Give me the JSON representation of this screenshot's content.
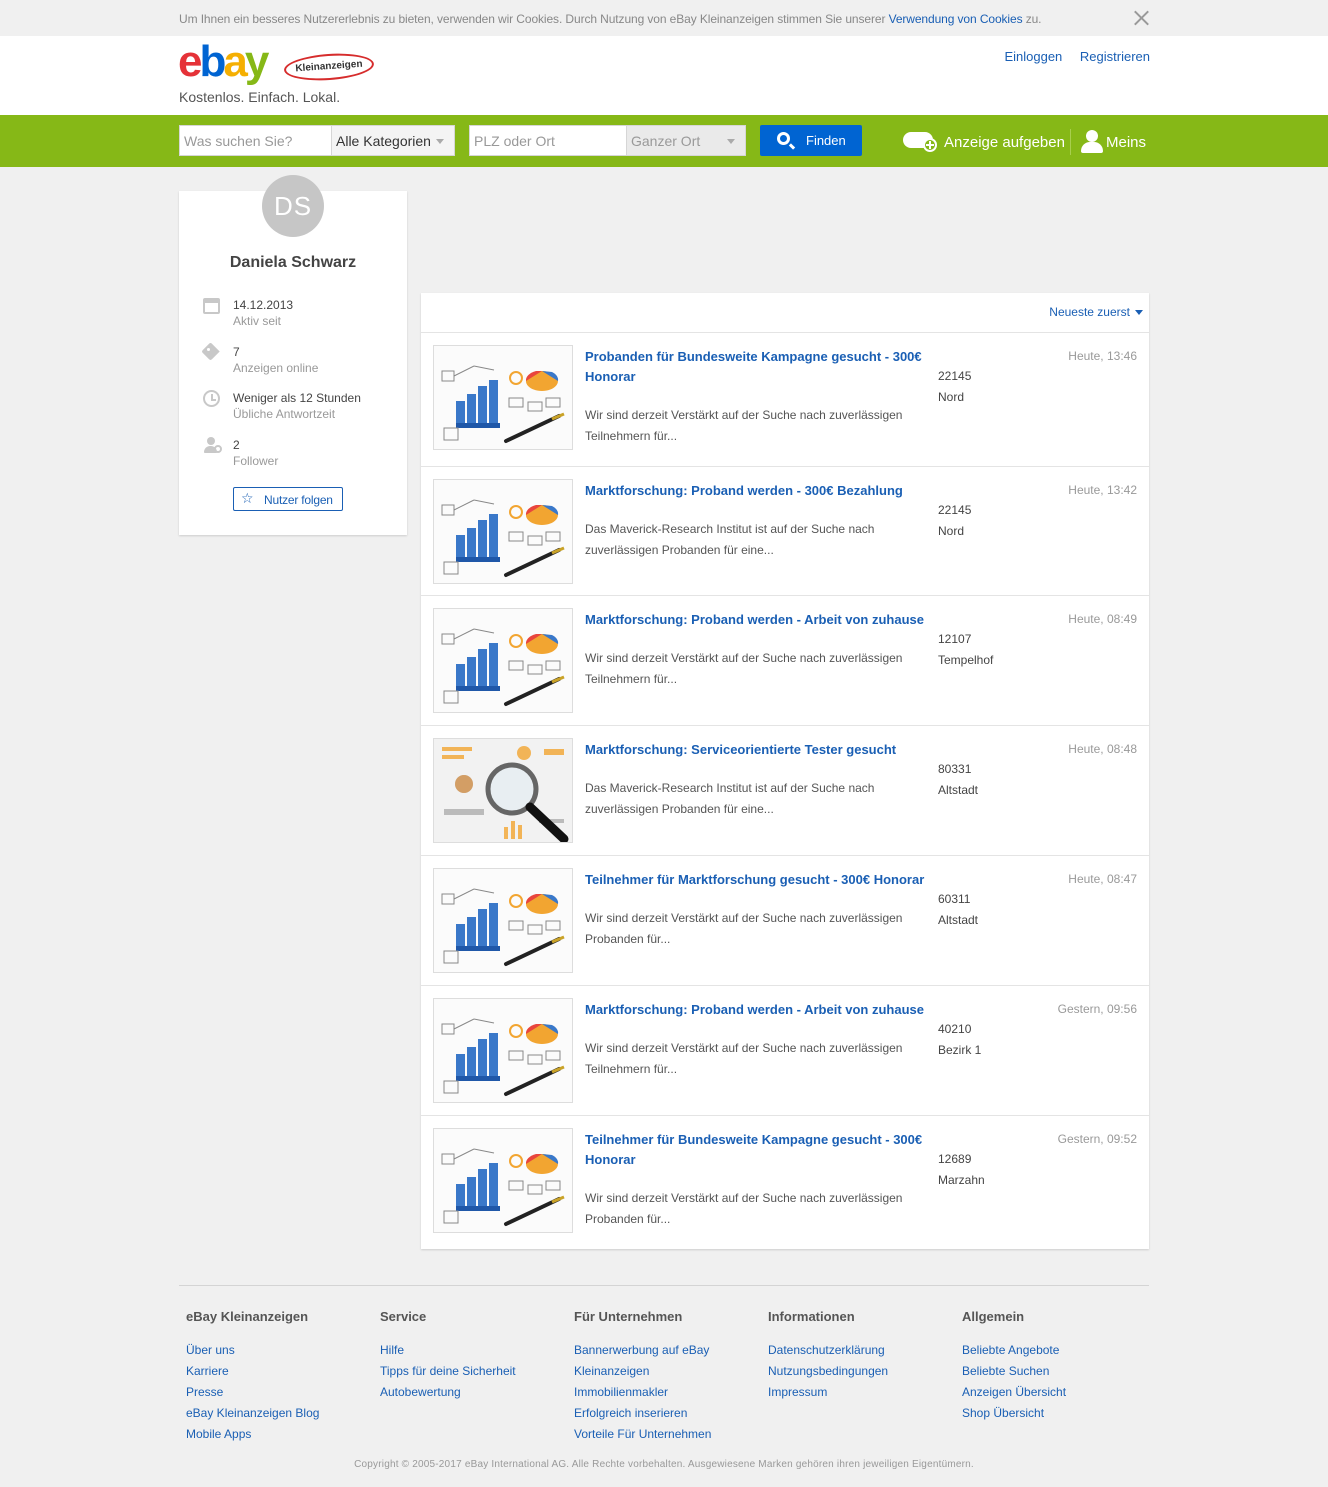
{
  "cookie": {
    "text": "Um Ihnen ein besseres Nutzererlebnis zu bieten, verwenden wir Cookies. Durch Nutzung von eBay Kleinanzeigen stimmen Sie unserer ",
    "link": "Verwendung von Cookies",
    "suffix": " zu."
  },
  "header": {
    "logo_e": "e",
    "logo_b": "b",
    "logo_a": "a",
    "logo_y": "y",
    "logo_badge": "Kleinanzeigen",
    "tagline": "Kostenlos. Einfach. Lokal.",
    "login": "Einloggen",
    "register": "Registrieren"
  },
  "search": {
    "query_placeholder": "Was suchen Sie?",
    "category": "Alle Kategorien",
    "location_placeholder": "PLZ oder Ort",
    "radius": "Ganzer Ort",
    "find": "Finden",
    "post_ad": "Anzeige aufgeben",
    "meins": "Meins"
  },
  "profile": {
    "initials": "DS",
    "name": "Daniela Schwarz",
    "stats": [
      {
        "value": "14.12.2013",
        "label": "Aktiv seit"
      },
      {
        "value": "7",
        "label": "Anzeigen online"
      },
      {
        "value": "Weniger als 12 Stunden",
        "label": "Übliche Antwortzeit"
      },
      {
        "value": "2",
        "label": "Follower"
      }
    ],
    "follow": "Nutzer folgen"
  },
  "sort": "Neueste zuerst",
  "listings": [
    {
      "title": "Probanden für Bundesweite Kampagne gesucht - 300€ Honorar",
      "desc": "Wir sind derzeit Verstärkt auf der Suche nach zuverlässigen Teilnehmern für...",
      "zip": "22145",
      "district": "Nord",
      "date": "Heute, 13:46",
      "img": "chart"
    },
    {
      "title": "Marktforschung: Proband werden - 300€ Bezahlung",
      "desc": "Das Maverick-Research Institut ist auf der Suche nach zuverlässigen Probanden für eine...",
      "zip": "22145",
      "district": "Nord",
      "date": "Heute, 13:42",
      "img": "chart"
    },
    {
      "title": "Marktforschung: Proband werden - Arbeit von zuhause",
      "desc": "Wir sind derzeit Verstärkt auf der Suche nach zuverlässigen Teilnehmern für...",
      "zip": "12107",
      "district": "Tempelhof",
      "date": "Heute, 08:49",
      "img": "chart"
    },
    {
      "title": "Marktforschung: Serviceorientierte Tester gesucht",
      "desc": "Das Maverick-Research Institut ist auf der Suche nach zuverlässigen Probanden für eine...",
      "zip": "80331",
      "district": "Altstadt",
      "date": "Heute, 08:48",
      "img": "magnifier"
    },
    {
      "title": "Teilnehmer für Marktforschung gesucht - 300€ Honorar",
      "desc": "Wir sind derzeit Verstärkt auf der Suche nach zuverlässigen Probanden für...",
      "zip": "60311",
      "district": "Altstadt",
      "date": "Heute, 08:47",
      "img": "chart"
    },
    {
      "title": "Marktforschung: Proband werden - Arbeit von zuhause",
      "desc": "Wir sind derzeit Verstärkt auf der Suche nach zuverlässigen Teilnehmern für...",
      "zip": "40210",
      "district": "Bezirk 1",
      "date": "Gestern, 09:56",
      "img": "chart"
    },
    {
      "title": "Teilnehmer für Bundesweite Kampagne gesucht - 300€ Honorar",
      "desc": "Wir sind derzeit Verstärkt auf der Suche nach zuverlässigen Probanden für...",
      "zip": "12689",
      "district": "Marzahn",
      "date": "Gestern, 09:52",
      "img": "chart"
    }
  ],
  "footer": {
    "columns": [
      {
        "title": "eBay Kleinanzeigen",
        "links": [
          "Über uns",
          "Karriere",
          "Presse",
          "eBay Kleinanzeigen Blog",
          "Mobile Apps"
        ]
      },
      {
        "title": "Service",
        "links": [
          "Hilfe",
          "Tipps für deine Sicherheit",
          "Autobewertung"
        ]
      },
      {
        "title": "Für Unternehmen",
        "links": [
          "Bannerwerbung auf eBay Kleinanzeigen",
          "Immobilienmakler",
          "Erfolgreich inserieren",
          "Vorteile Für Unternehmen"
        ]
      },
      {
        "title": "Informationen",
        "links": [
          "Datenschutzerklärung",
          "Nutzungsbedingungen",
          "Impressum"
        ]
      },
      {
        "title": "Allgemein",
        "links": [
          "Beliebte Angebote",
          "Beliebte Suchen",
          "Anzeigen Übersicht",
          "Shop Übersicht"
        ]
      }
    ],
    "copyright": "Copyright © 2005-2017 eBay International AG. Alle Rechte vorbehalten. Ausgewiesene Marken gehören ihren jeweiligen Eigentümern."
  },
  "colors": {
    "brand_green": "#86b817",
    "link_blue": "#1a5fb4",
    "button_blue": "#0064d2"
  }
}
